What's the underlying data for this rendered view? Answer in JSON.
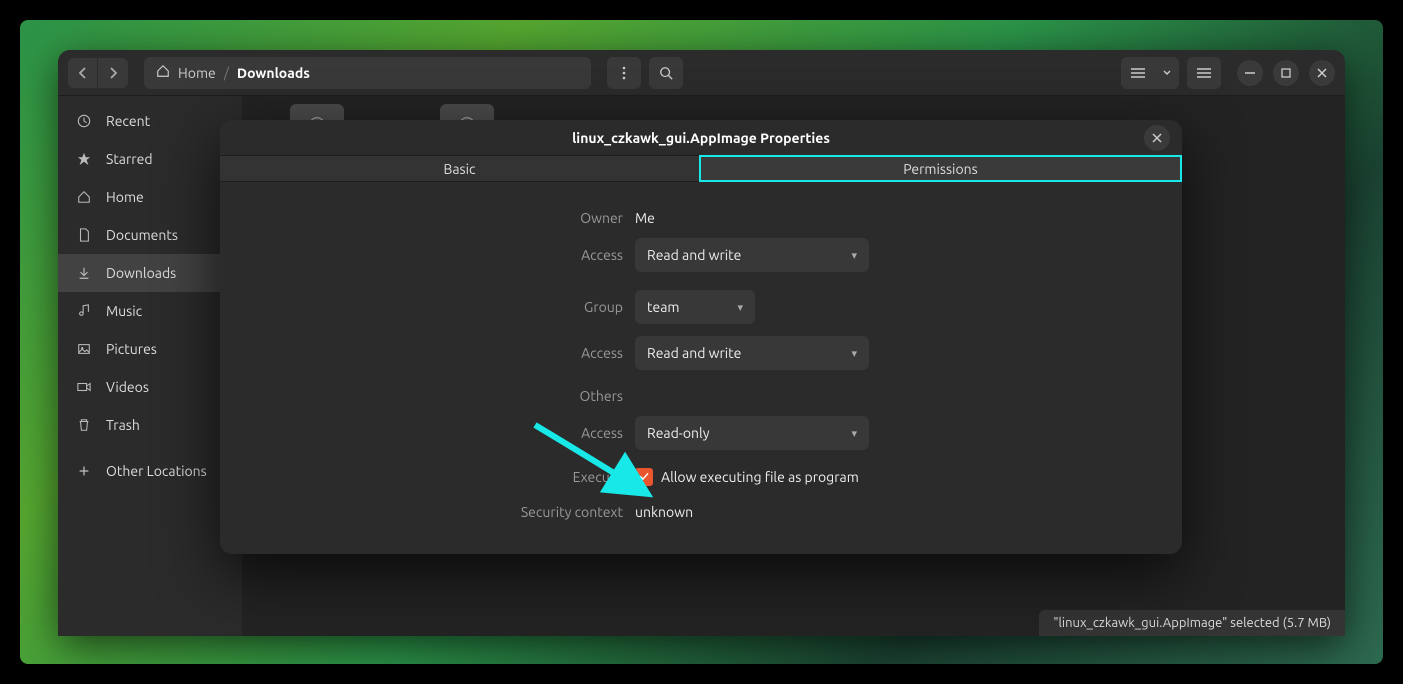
{
  "breadcrumb": {
    "home": "Home",
    "current": "Downloads"
  },
  "sidebar": {
    "items": [
      {
        "icon": "clock",
        "label": "Recent"
      },
      {
        "icon": "star",
        "label": "Starred"
      },
      {
        "icon": "home",
        "label": "Home"
      },
      {
        "icon": "doc",
        "label": "Documents"
      },
      {
        "icon": "download",
        "label": "Downloads"
      },
      {
        "icon": "music",
        "label": "Music"
      },
      {
        "icon": "picture",
        "label": "Pictures"
      },
      {
        "icon": "video",
        "label": "Videos"
      },
      {
        "icon": "trash",
        "label": "Trash"
      },
      {
        "icon": "plus",
        "label": "Other Locations"
      }
    ]
  },
  "statusbar": {
    "text": "\"linux_czkawk_gui.AppImage\" selected  (5.7 MB)"
  },
  "dialog": {
    "title": "linux_czkawk_gui.AppImage Properties",
    "tabs": {
      "basic": "Basic",
      "permissions": "Permissions"
    },
    "owner": {
      "label": "Owner",
      "value": "Me"
    },
    "owner_access": {
      "label": "Access",
      "value": "Read and write"
    },
    "group": {
      "label": "Group",
      "value": "team"
    },
    "group_access": {
      "label": "Access",
      "value": "Read and write"
    },
    "others": {
      "label": "Others"
    },
    "others_access": {
      "label": "Access",
      "value": "Read-only"
    },
    "execute": {
      "label": "Execute",
      "checkbox_label": "Allow executing file as program",
      "checked": true
    },
    "security": {
      "label": "Security context",
      "value": "unknown"
    }
  }
}
